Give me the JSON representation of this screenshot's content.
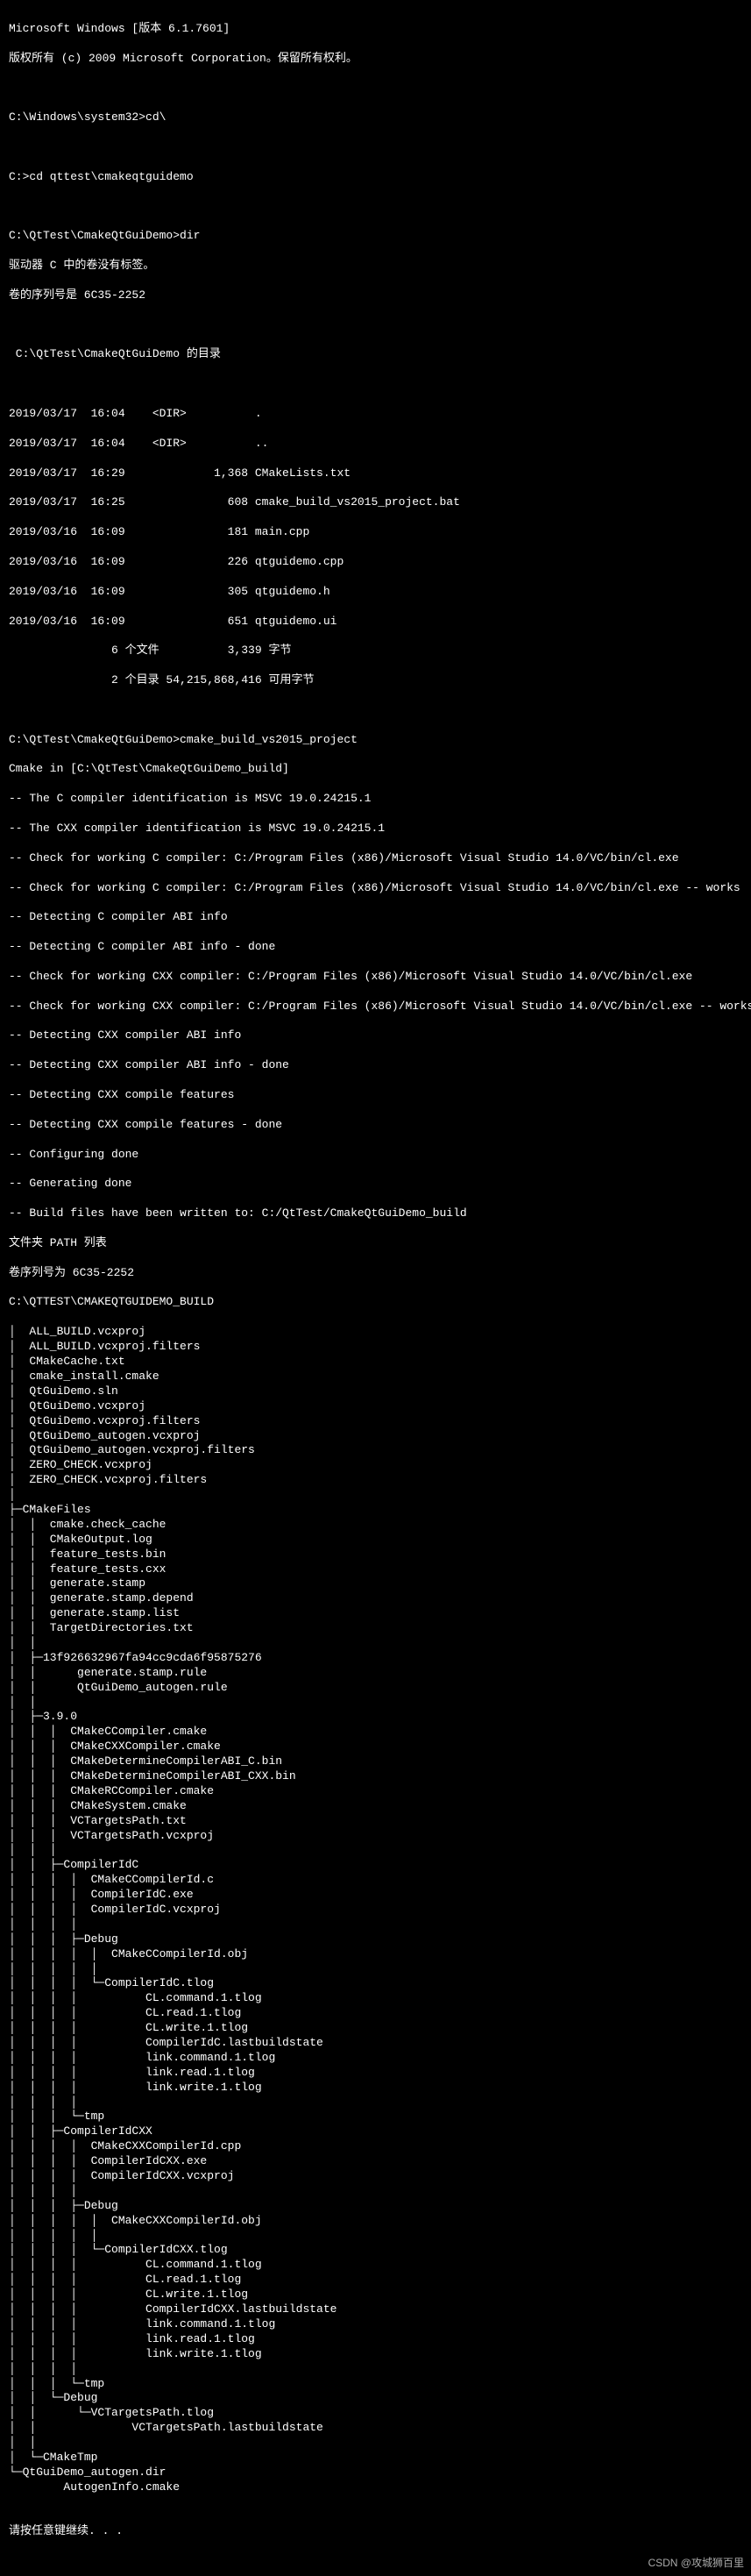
{
  "header": {
    "line1": "Microsoft Windows [版本 6.1.7601]",
    "line2": "版权所有 (c) 2009 Microsoft Corporation。保留所有权利。"
  },
  "prompts": {
    "p1": "C:\\Windows\\system32>cd\\",
    "p2": "C:>cd qttest\\cmakeqtguidemo",
    "p3": "C:\\QtTest\\CmakeQtGuiDemo>dir",
    "drive_msg": "驱动器 C 中的卷没有标签。",
    "serial_msg": "卷的序列号是 6C35-2252",
    "dir_header": " C:\\QtTest\\CmakeQtGuiDemo 的目录"
  },
  "dir_listing": [
    "2019/03/17  16:04    <DIR>          .",
    "2019/03/17  16:04    <DIR>          ..",
    "2019/03/17  16:29             1,368 CMakeLists.txt",
    "2019/03/17  16:25               608 cmake_build_vs2015_project.bat",
    "2019/03/16  16:09               181 main.cpp",
    "2019/03/16  16:09               226 qtguidemo.cpp",
    "2019/03/16  16:09               305 qtguidemo.h",
    "2019/03/16  16:09               651 qtguidemo.ui",
    "               6 个文件          3,339 字节",
    "               2 个目录 54,215,868,416 可用字节"
  ],
  "cmake_cmd": "C:\\QtTest\\CmakeQtGuiDemo>cmake_build_vs2015_project",
  "cmake_output": [
    "Cmake in [C:\\QtTest\\CmakeQtGuiDemo_build]",
    "-- The C compiler identification is MSVC 19.0.24215.1",
    "-- The CXX compiler identification is MSVC 19.0.24215.1",
    "-- Check for working C compiler: C:/Program Files (x86)/Microsoft Visual Studio 14.0/VC/bin/cl.exe",
    "-- Check for working C compiler: C:/Program Files (x86)/Microsoft Visual Studio 14.0/VC/bin/cl.exe -- works",
    "-- Detecting C compiler ABI info",
    "-- Detecting C compiler ABI info - done",
    "-- Check for working CXX compiler: C:/Program Files (x86)/Microsoft Visual Studio 14.0/VC/bin/cl.exe",
    "-- Check for working CXX compiler: C:/Program Files (x86)/Microsoft Visual Studio 14.0/VC/bin/cl.exe -- works",
    "-- Detecting CXX compiler ABI info",
    "-- Detecting CXX compiler ABI info - done",
    "-- Detecting CXX compile features",
    "-- Detecting CXX compile features - done",
    "-- Configuring done",
    "-- Generating done",
    "-- Build files have been written to: C:/QtTest/CmakeQtGuiDemo_build"
  ],
  "tree_header": {
    "l1": "文件夹 PATH 列表",
    "l2": "卷序列号为 6C35-2252",
    "l3": "C:\\QTTEST\\CMAKEQTGUIDEMO_BUILD"
  },
  "tree": [
    "│  ALL_BUILD.vcxproj",
    "│  ALL_BUILD.vcxproj.filters",
    "│  CMakeCache.txt",
    "│  cmake_install.cmake",
    "│  QtGuiDemo.sln",
    "│  QtGuiDemo.vcxproj",
    "│  QtGuiDemo.vcxproj.filters",
    "│  QtGuiDemo_autogen.vcxproj",
    "│  QtGuiDemo_autogen.vcxproj.filters",
    "│  ZERO_CHECK.vcxproj",
    "│  ZERO_CHECK.vcxproj.filters",
    "│",
    "├─CMakeFiles",
    "│  │  cmake.check_cache",
    "│  │  CMakeOutput.log",
    "│  │  feature_tests.bin",
    "│  │  feature_tests.cxx",
    "│  │  generate.stamp",
    "│  │  generate.stamp.depend",
    "│  │  generate.stamp.list",
    "│  │  TargetDirectories.txt",
    "│  │",
    "│  ├─13f926632967fa94cc9cda6f95875276",
    "│  │      generate.stamp.rule",
    "│  │      QtGuiDemo_autogen.rule",
    "│  │",
    "│  ├─3.9.0",
    "│  │  │  CMakeCCompiler.cmake",
    "│  │  │  CMakeCXXCompiler.cmake",
    "│  │  │  CMakeDetermineCompilerABI_C.bin",
    "│  │  │  CMakeDetermineCompilerABI_CXX.bin",
    "│  │  │  CMakeRCCompiler.cmake",
    "│  │  │  CMakeSystem.cmake",
    "│  │  │  VCTargetsPath.txt",
    "│  │  │  VCTargetsPath.vcxproj",
    "│  │  │",
    "│  │  ├─CompilerIdC",
    "│  │  │  │  CMakeCCompilerId.c",
    "│  │  │  │  CompilerIdC.exe",
    "│  │  │  │  CompilerIdC.vcxproj",
    "│  │  │  │",
    "│  │  │  ├─Debug",
    "│  │  │  │  │  CMakeCCompilerId.obj",
    "│  │  │  │  │",
    "│  │  │  │  └─CompilerIdC.tlog",
    "│  │  │  │          CL.command.1.tlog",
    "│  │  │  │          CL.read.1.tlog",
    "│  │  │  │          CL.write.1.tlog",
    "│  │  │  │          CompilerIdC.lastbuildstate",
    "│  │  │  │          link.command.1.tlog",
    "│  │  │  │          link.read.1.tlog",
    "│  │  │  │          link.write.1.tlog",
    "│  │  │  │",
    "│  │  │  └─tmp",
    "│  │  ├─CompilerIdCXX",
    "│  │  │  │  CMakeCXXCompilerId.cpp",
    "│  │  │  │  CompilerIdCXX.exe",
    "│  │  │  │  CompilerIdCXX.vcxproj",
    "│  │  │  │",
    "│  │  │  ├─Debug",
    "│  │  │  │  │  CMakeCXXCompilerId.obj",
    "│  │  │  │  │",
    "│  │  │  │  └─CompilerIdCXX.tlog",
    "│  │  │  │          CL.command.1.tlog",
    "│  │  │  │          CL.read.1.tlog",
    "│  │  │  │          CL.write.1.tlog",
    "│  │  │  │          CompilerIdCXX.lastbuildstate",
    "│  │  │  │          link.command.1.tlog",
    "│  │  │  │          link.read.1.tlog",
    "│  │  │  │          link.write.1.tlog",
    "│  │  │  │",
    "│  │  │  └─tmp",
    "│  │  └─Debug",
    "│  │      └─VCTargetsPath.tlog",
    "│  │              VCTargetsPath.lastbuildstate",
    "│  │",
    "│  └─CMakeTmp",
    "└─QtGuiDemo_autogen.dir",
    "        AutogenInfo.cmake",
    ""
  ],
  "footer": "请按任意键继续. . .",
  "watermark": "CSDN @攻城狮百里"
}
